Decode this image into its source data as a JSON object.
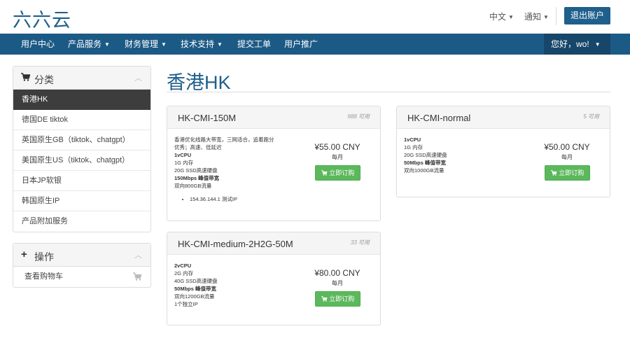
{
  "header": {
    "logo": "六六云",
    "language": "中文",
    "notifications": "通知",
    "logout": "退出账户"
  },
  "nav": {
    "items": [
      {
        "label": "用户中心"
      },
      {
        "label": "产品服务"
      },
      {
        "label": "财务管理"
      },
      {
        "label": "技术支持"
      },
      {
        "label": "提交工单"
      },
      {
        "label": "用户推广"
      }
    ],
    "greeting": "您好，wo!"
  },
  "sidebar": {
    "categories_title": "分类",
    "categories": [
      {
        "label": "香港HK"
      },
      {
        "label": "德国DE tiktok"
      },
      {
        "label": "英国原生GB（tiktok、chatgpt）"
      },
      {
        "label": "美国原生US（tiktok、chatgpt）"
      },
      {
        "label": "日本JP软银"
      },
      {
        "label": "韩国原生IP"
      },
      {
        "label": "产品附加服务"
      }
    ],
    "actions_title": "操作",
    "actions": [
      {
        "label": "查看购物车"
      }
    ]
  },
  "page": {
    "title": "香港HK"
  },
  "products": [
    {
      "name": "HK-CMI-150M",
      "available": "988 可用",
      "desc_lines": [
        {
          "text": "香港优化线路大带宽，三网适合，追着跑分",
          "bold": false
        },
        {
          "text": "优秀；高速、低延迟",
          "bold": false
        },
        {
          "text": "1vCPU",
          "bold": true
        },
        {
          "text": "1G 内存",
          "bold": false
        },
        {
          "text": "20G SSD高速硬盘",
          "bold": false
        },
        {
          "text": "150Mbps 峰值带宽",
          "bold": true
        },
        {
          "text": "双向800GB流量",
          "bold": false
        }
      ],
      "bullets": [
        "154.36.144.1 测试IP"
      ],
      "price": "¥55.00 CNY",
      "cycle": "每月",
      "order": "立即订购"
    },
    {
      "name": "HK-CMI-normal",
      "available": "5 可用",
      "desc_lines": [
        {
          "text": "1vCPU",
          "bold": true
        },
        {
          "text": "1G 内存",
          "bold": false
        },
        {
          "text": "20G SSD高速硬盘",
          "bold": false
        },
        {
          "text": "50Mbps 峰值带宽",
          "bold": true
        },
        {
          "text": "双向1000GB流量",
          "bold": false
        }
      ],
      "bullets": [],
      "price": "¥50.00 CNY",
      "cycle": "每月",
      "order": "立即订购"
    },
    {
      "name": "HK-CMI-medium-2H2G-50M",
      "available": "33 可用",
      "desc_lines": [
        {
          "text": "2vCPU",
          "bold": true
        },
        {
          "text": "2G 内存",
          "bold": false
        },
        {
          "text": "40G SSD高速硬盘",
          "bold": false
        },
        {
          "text": "50Mbps 峰值带宽",
          "bold": true
        },
        {
          "text": "双向1200GB流量",
          "bold": false
        },
        {
          "text": "1个独立IP",
          "bold": false
        }
      ],
      "bullets": [],
      "price": "¥80.00 CNY",
      "cycle": "每月",
      "order": "立即订购"
    }
  ],
  "icons": {
    "categories": "cart-icon",
    "actions": "plus-icon",
    "order": "cart-icon",
    "collapse": "chevron-up-icon"
  },
  "colors": {
    "brand": "#1f5f8b",
    "navbar": "#1c5a86",
    "active_item": "#3d3d3d",
    "order_button": "#5cb85c"
  }
}
